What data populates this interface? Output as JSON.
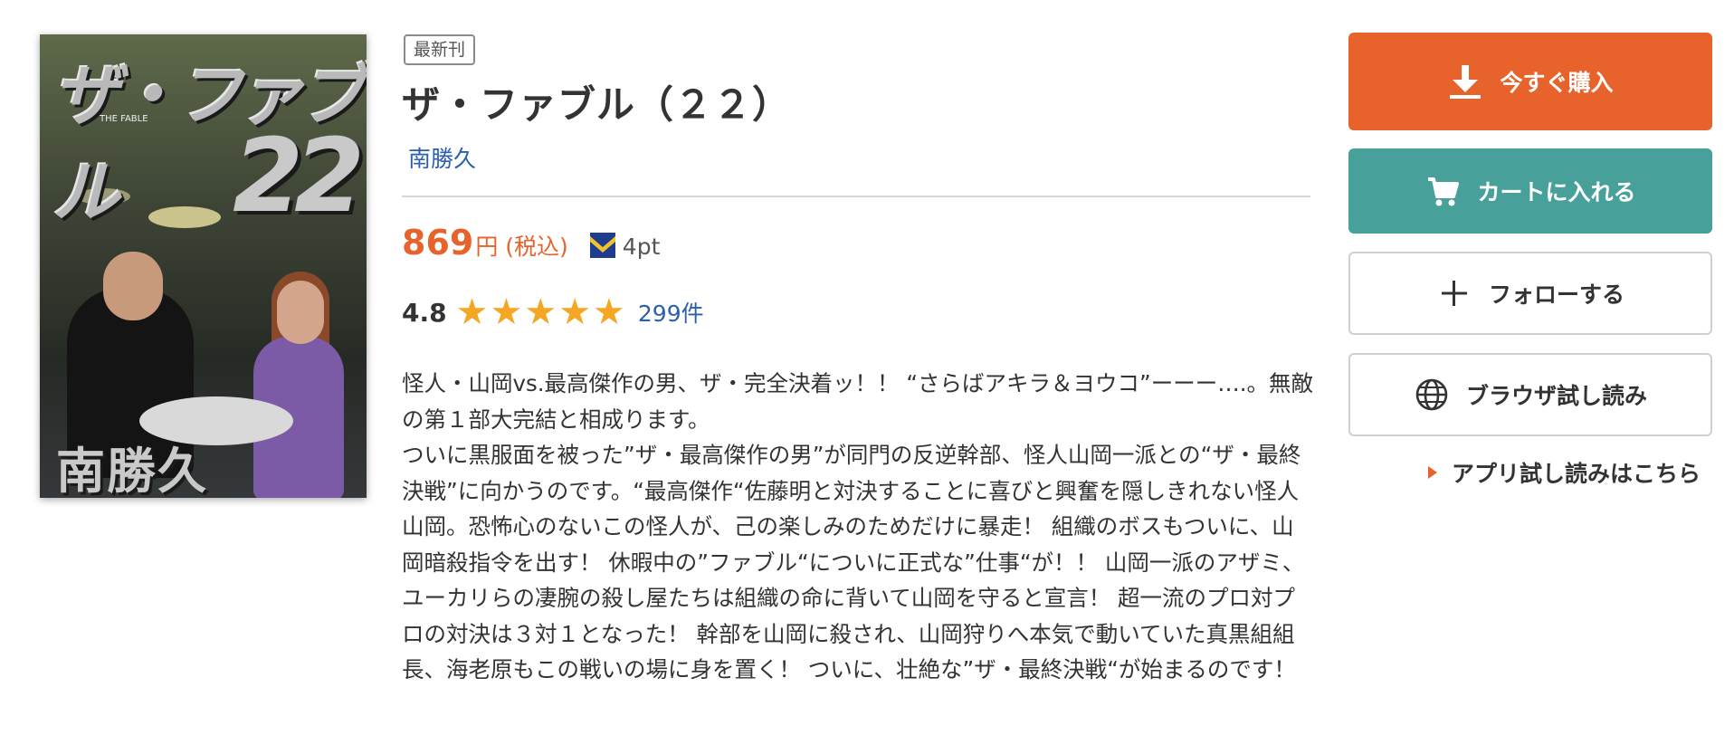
{
  "product": {
    "badge": "最新刊",
    "title": "ザ・ファブル（２２）",
    "author": "南勝久",
    "price": "869",
    "price_unit": "円 (税込)",
    "points": "4pt",
    "rating": "4.8",
    "star_count": 5,
    "reviews": "299件",
    "description": [
      "怪人・山岡vs.最高傑作の男、ザ・完全決着ッ！！ “さらばアキラ＆ヨウコ”ーーー….。無敵の第１部大完結と相成ります。",
      "ついに黒服面を被った”ザ・最高傑作の男”が同門の反逆幹部、怪人山岡一派との“ザ・最終決戦”に向かうのです。“最高傑作“佐藤明と対決することに喜びと興奮を隠しきれない怪人山岡。恐怖心のないこの怪人が、己の楽しみのためだけに暴走！ 組織のボスもついに、山岡暗殺指令を出す！ 休暇中の”ファブル“についに正式な”仕事“が！！ 山岡一派のアザミ、ユーカリらの凄腕の殺し屋たちは組織の命に背いて山岡を守ると宣言！ 超一流のプロ対プロの対決は３対１となった！ 幹部を山岡に殺され、山岡狩りへ本気で動いていた真黒組組長、海老原もこの戦いの場に身を置く！ ついに、壮絶な”ザ・最終決戦“が始まるのです！"
    ]
  },
  "cover": {
    "title_text": "ザ・ファブル",
    "subtitle_text": "THE FABLE",
    "volume_text": "22",
    "author_text": "南勝久"
  },
  "actions": {
    "buy_label": "今すぐ購入",
    "cart_label": "カートに入れる",
    "follow_label": "フォローする",
    "preview_label": "ブラウザ試し読み",
    "app_link_label": "アプリ試し読みはこちら"
  },
  "colors": {
    "accent_orange": "#e8632b",
    "teal": "#48a09b",
    "link_blue": "#2b5fb0",
    "star": "#f5a623"
  },
  "icons": {
    "buy": "download-icon",
    "cart": "cart-icon",
    "follow": "plus-icon",
    "preview": "globe-icon",
    "points": "point-badge-icon",
    "app_link": "triangle-right-icon"
  }
}
